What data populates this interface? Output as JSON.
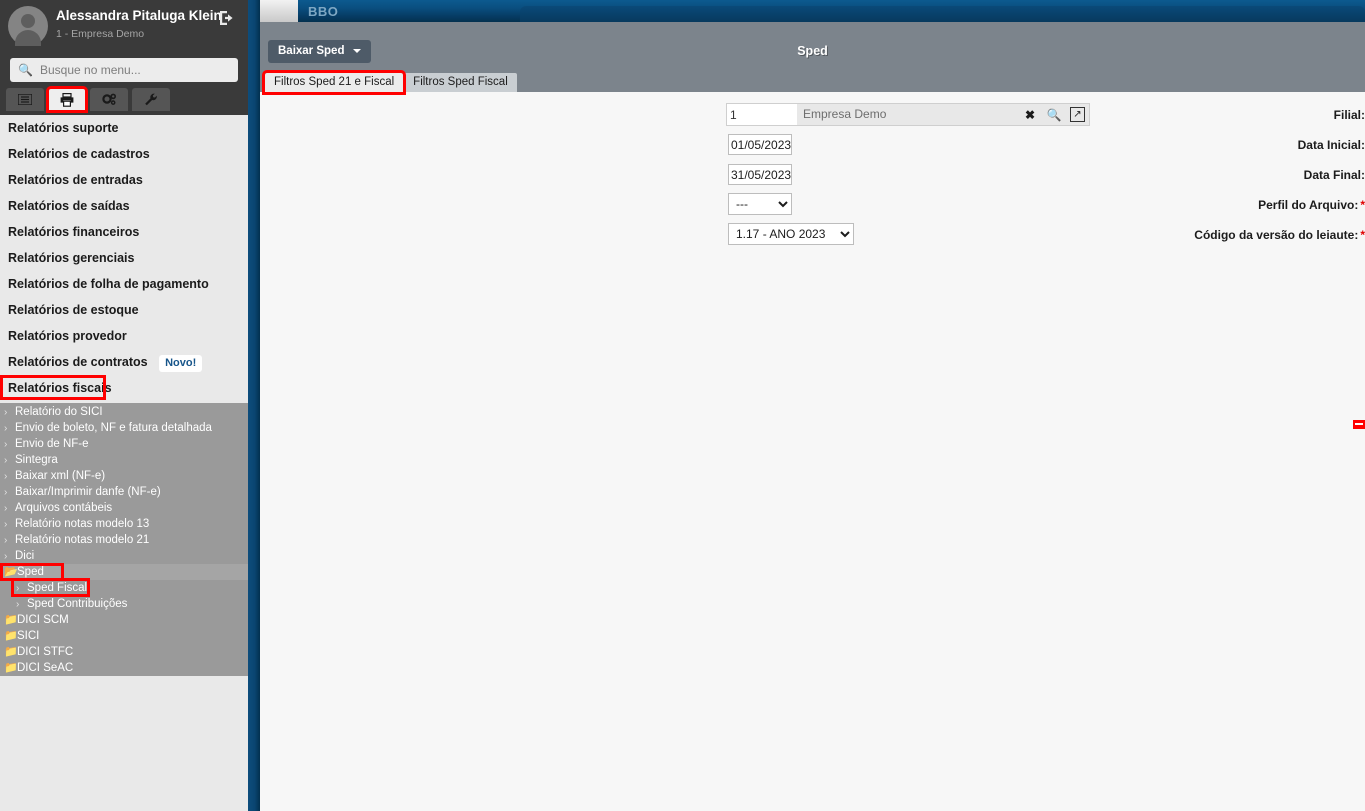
{
  "topbar": {
    "brand": "BBO"
  },
  "user": {
    "name": "Alessandra Pitaluga Klein",
    "company": "1 - Empresa Demo",
    "logout_icon": "logout-icon",
    "avatar_icon": "avatar"
  },
  "search": {
    "placeholder": "Busque no menu...",
    "value": "",
    "icon": "search-icon"
  },
  "icon_tabs": [
    {
      "name": "tab-menu",
      "glyph": "▤",
      "active": false,
      "highlighted": false
    },
    {
      "name": "tab-reports",
      "glyph": "⎙",
      "active": true,
      "highlighted": true
    },
    {
      "name": "tab-settings",
      "glyph": "⚙",
      "active": false,
      "highlighted": false
    },
    {
      "name": "tab-tools",
      "glyph": "🔧",
      "active": false,
      "highlighted": false
    }
  ],
  "menu": {
    "items": [
      {
        "label": "Relatórios suporte",
        "badge": "",
        "highlighted": false
      },
      {
        "label": "Relatórios de cadastros",
        "badge": "",
        "highlighted": false
      },
      {
        "label": "Relatórios de entradas",
        "badge": "",
        "highlighted": false
      },
      {
        "label": "Relatórios de saídas",
        "badge": "",
        "highlighted": false
      },
      {
        "label": "Relatórios financeiros",
        "badge": "",
        "highlighted": false
      },
      {
        "label": "Relatórios gerenciais",
        "badge": "",
        "highlighted": false
      },
      {
        "label": "Relatórios de folha de pagamento",
        "badge": "",
        "highlighted": false
      },
      {
        "label": "Relatórios de estoque",
        "badge": "",
        "highlighted": false
      },
      {
        "label": "Relatórios provedor",
        "badge": "",
        "highlighted": false
      },
      {
        "label": "Relatórios de contratos",
        "badge": "Novo!",
        "highlighted": false
      },
      {
        "label": "Relatórios fiscais",
        "badge": "",
        "highlighted": true
      }
    ]
  },
  "submenu": {
    "items": [
      {
        "label": "Relatório do SICI",
        "type": "link",
        "level": 1
      },
      {
        "label": "Envio de boleto, NF e fatura detalhada",
        "type": "link",
        "level": 1
      },
      {
        "label": "Envio de NF-e",
        "type": "link",
        "level": 1
      },
      {
        "label": "Sintegra",
        "type": "link",
        "level": 1
      },
      {
        "label": "Baixar xml (NF-e)",
        "type": "link",
        "level": 1
      },
      {
        "label": "Baixar/Imprimir danfe (NF-e)",
        "type": "link",
        "level": 1
      },
      {
        "label": "Arquivos contábeis",
        "type": "link",
        "level": 1
      },
      {
        "label": "Relatório notas modelo 13",
        "type": "link",
        "level": 1
      },
      {
        "label": "Relatório notas modelo 21",
        "type": "link",
        "level": 1
      },
      {
        "label": "Dici",
        "type": "link",
        "level": 1
      },
      {
        "label": "Sped",
        "type": "folder-open",
        "level": 1,
        "highlight": "sped"
      },
      {
        "label": "Sped Fiscal",
        "type": "link",
        "level": 2,
        "highlight": "spedfiscal"
      },
      {
        "label": "Sped Contribuições",
        "type": "link",
        "level": 2
      },
      {
        "label": "DICI SCM",
        "type": "folder",
        "level": 1
      },
      {
        "label": "SICI",
        "type": "folder",
        "level": 1
      },
      {
        "label": "DICI STFC",
        "type": "folder",
        "level": 1
      },
      {
        "label": "DICI SeAC",
        "type": "folder",
        "level": 1
      }
    ]
  },
  "page": {
    "title": "Sped",
    "action_button": "Baixar Sped"
  },
  "tabs": [
    {
      "label": "Filtros Sped 21 e Fiscal",
      "active": true,
      "highlighted": true
    },
    {
      "label": "Filtros Sped Fiscal",
      "active": false,
      "highlighted": false
    }
  ],
  "form": {
    "filial": {
      "label": "Filial:",
      "code": "1",
      "description": "Empresa Demo",
      "clear_icon": "close-icon",
      "search_icon": "search-icon",
      "open_icon": "external-link-icon"
    },
    "data_inicial": {
      "label": "Data Inicial:",
      "value": "01/05/2023"
    },
    "data_final": {
      "label": "Data Final:",
      "value": "31/05/2023"
    },
    "perfil_arquivo": {
      "label": "Perfil do Arquivo:",
      "required": "*",
      "value": "---",
      "options": [
        "---"
      ]
    },
    "codigo_versao": {
      "label": "Código da versão do leiaute:",
      "required": "*",
      "value": "1.17 - ANO 2023",
      "options": [
        "1.17 - ANO 2023"
      ]
    }
  },
  "colors": {
    "accent_blue": "#0a4571",
    "sidebar_dark": "#3a3a3a",
    "submenu_gray": "#9a9a9a",
    "header_gray": "#7c848c",
    "highlight_red": "#ff0000",
    "button_slate": "#4e5b68"
  }
}
